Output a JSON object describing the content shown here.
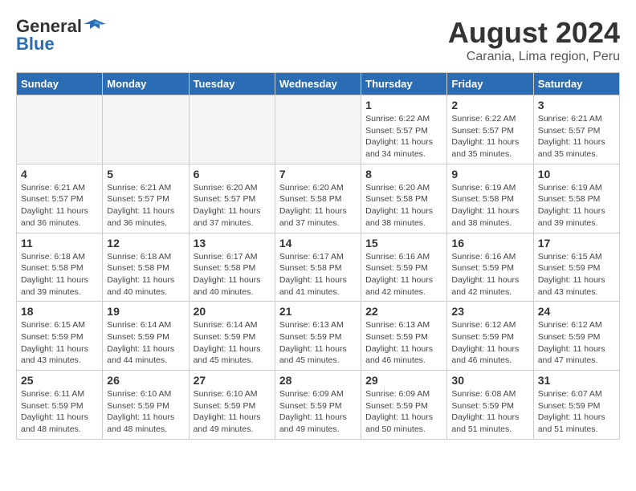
{
  "header": {
    "logo_general": "General",
    "logo_blue": "Blue",
    "month_year": "August 2024",
    "location": "Carania, Lima region, Peru"
  },
  "days_of_week": [
    "Sunday",
    "Monday",
    "Tuesday",
    "Wednesday",
    "Thursday",
    "Friday",
    "Saturday"
  ],
  "weeks": [
    [
      {
        "day": "",
        "info": ""
      },
      {
        "day": "",
        "info": ""
      },
      {
        "day": "",
        "info": ""
      },
      {
        "day": "",
        "info": ""
      },
      {
        "day": "1",
        "info": "Sunrise: 6:22 AM\nSunset: 5:57 PM\nDaylight: 11 hours\nand 34 minutes."
      },
      {
        "day": "2",
        "info": "Sunrise: 6:22 AM\nSunset: 5:57 PM\nDaylight: 11 hours\nand 35 minutes."
      },
      {
        "day": "3",
        "info": "Sunrise: 6:21 AM\nSunset: 5:57 PM\nDaylight: 11 hours\nand 35 minutes."
      }
    ],
    [
      {
        "day": "4",
        "info": "Sunrise: 6:21 AM\nSunset: 5:57 PM\nDaylight: 11 hours\nand 36 minutes."
      },
      {
        "day": "5",
        "info": "Sunrise: 6:21 AM\nSunset: 5:57 PM\nDaylight: 11 hours\nand 36 minutes."
      },
      {
        "day": "6",
        "info": "Sunrise: 6:20 AM\nSunset: 5:57 PM\nDaylight: 11 hours\nand 37 minutes."
      },
      {
        "day": "7",
        "info": "Sunrise: 6:20 AM\nSunset: 5:58 PM\nDaylight: 11 hours\nand 37 minutes."
      },
      {
        "day": "8",
        "info": "Sunrise: 6:20 AM\nSunset: 5:58 PM\nDaylight: 11 hours\nand 38 minutes."
      },
      {
        "day": "9",
        "info": "Sunrise: 6:19 AM\nSunset: 5:58 PM\nDaylight: 11 hours\nand 38 minutes."
      },
      {
        "day": "10",
        "info": "Sunrise: 6:19 AM\nSunset: 5:58 PM\nDaylight: 11 hours\nand 39 minutes."
      }
    ],
    [
      {
        "day": "11",
        "info": "Sunrise: 6:18 AM\nSunset: 5:58 PM\nDaylight: 11 hours\nand 39 minutes."
      },
      {
        "day": "12",
        "info": "Sunrise: 6:18 AM\nSunset: 5:58 PM\nDaylight: 11 hours\nand 40 minutes."
      },
      {
        "day": "13",
        "info": "Sunrise: 6:17 AM\nSunset: 5:58 PM\nDaylight: 11 hours\nand 40 minutes."
      },
      {
        "day": "14",
        "info": "Sunrise: 6:17 AM\nSunset: 5:58 PM\nDaylight: 11 hours\nand 41 minutes."
      },
      {
        "day": "15",
        "info": "Sunrise: 6:16 AM\nSunset: 5:59 PM\nDaylight: 11 hours\nand 42 minutes."
      },
      {
        "day": "16",
        "info": "Sunrise: 6:16 AM\nSunset: 5:59 PM\nDaylight: 11 hours\nand 42 minutes."
      },
      {
        "day": "17",
        "info": "Sunrise: 6:15 AM\nSunset: 5:59 PM\nDaylight: 11 hours\nand 43 minutes."
      }
    ],
    [
      {
        "day": "18",
        "info": "Sunrise: 6:15 AM\nSunset: 5:59 PM\nDaylight: 11 hours\nand 43 minutes."
      },
      {
        "day": "19",
        "info": "Sunrise: 6:14 AM\nSunset: 5:59 PM\nDaylight: 11 hours\nand 44 minutes."
      },
      {
        "day": "20",
        "info": "Sunrise: 6:14 AM\nSunset: 5:59 PM\nDaylight: 11 hours\nand 45 minutes."
      },
      {
        "day": "21",
        "info": "Sunrise: 6:13 AM\nSunset: 5:59 PM\nDaylight: 11 hours\nand 45 minutes."
      },
      {
        "day": "22",
        "info": "Sunrise: 6:13 AM\nSunset: 5:59 PM\nDaylight: 11 hours\nand 46 minutes."
      },
      {
        "day": "23",
        "info": "Sunrise: 6:12 AM\nSunset: 5:59 PM\nDaylight: 11 hours\nand 46 minutes."
      },
      {
        "day": "24",
        "info": "Sunrise: 6:12 AM\nSunset: 5:59 PM\nDaylight: 11 hours\nand 47 minutes."
      }
    ],
    [
      {
        "day": "25",
        "info": "Sunrise: 6:11 AM\nSunset: 5:59 PM\nDaylight: 11 hours\nand 48 minutes."
      },
      {
        "day": "26",
        "info": "Sunrise: 6:10 AM\nSunset: 5:59 PM\nDaylight: 11 hours\nand 48 minutes."
      },
      {
        "day": "27",
        "info": "Sunrise: 6:10 AM\nSunset: 5:59 PM\nDaylight: 11 hours\nand 49 minutes."
      },
      {
        "day": "28",
        "info": "Sunrise: 6:09 AM\nSunset: 5:59 PM\nDaylight: 11 hours\nand 49 minutes."
      },
      {
        "day": "29",
        "info": "Sunrise: 6:09 AM\nSunset: 5:59 PM\nDaylight: 11 hours\nand 50 minutes."
      },
      {
        "day": "30",
        "info": "Sunrise: 6:08 AM\nSunset: 5:59 PM\nDaylight: 11 hours\nand 51 minutes."
      },
      {
        "day": "31",
        "info": "Sunrise: 6:07 AM\nSunset: 5:59 PM\nDaylight: 11 hours\nand 51 minutes."
      }
    ]
  ]
}
